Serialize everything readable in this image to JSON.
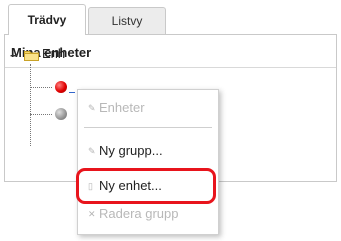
{
  "tabs": [
    {
      "label": "Trädvy",
      "active": true
    },
    {
      "label": "Listvy",
      "active": false
    }
  ],
  "panel": {
    "title": "Mina enheter"
  },
  "tree": {
    "root_label": "Enh",
    "collapse_symbol": "−"
  },
  "context_menu": {
    "items": [
      {
        "label": "Enheter",
        "enabled": false
      },
      {
        "label": "Ny grupp...",
        "enabled": true
      },
      {
        "label": "Ny enhet...",
        "enabled": true,
        "highlighted": true
      },
      {
        "label": "Radera grupp",
        "enabled": false
      }
    ]
  },
  "colors": {
    "highlight": "#e8141c",
    "status_red": "#e00000",
    "status_grey": "#999999"
  }
}
